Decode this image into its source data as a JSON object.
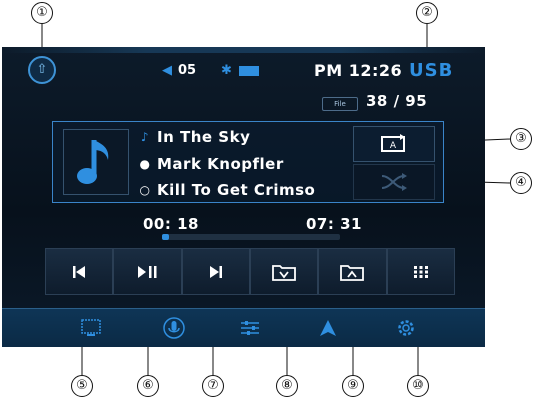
{
  "status_bar": {
    "volume_value": "05",
    "clock": "PM 12:26",
    "source": "USB",
    "file_label": "File",
    "file_count": "38 / 95"
  },
  "track": {
    "title": "In The Sky",
    "artist": "Mark Knopfler",
    "album": "Kill To Get Crimso"
  },
  "playback": {
    "elapsed": "00: 18",
    "total": "07: 31",
    "progress_fraction": 0.04
  },
  "controls": [
    "previous-track",
    "play-pause",
    "next-track",
    "folder-down",
    "folder-up",
    "menu-grid"
  ],
  "dock": [
    "media-icon",
    "voice-icon",
    "settings-sliders-icon",
    "navigation-icon",
    "gear-icon"
  ],
  "callouts": [
    "①",
    "②",
    "③",
    "④",
    "⑤",
    "⑥",
    "⑦",
    "⑧",
    "⑨",
    "⑩"
  ],
  "colors": {
    "accent": "#2f8fe0",
    "background": "#0d1b2a",
    "text": "#ffffff"
  }
}
